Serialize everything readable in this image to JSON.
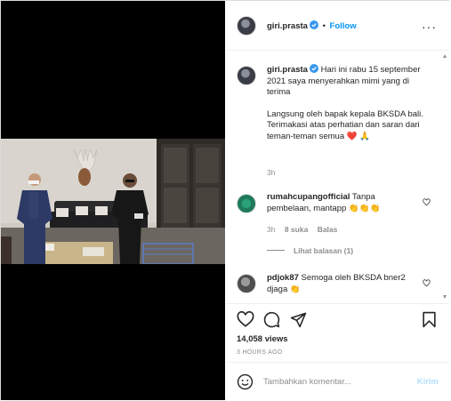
{
  "post": {
    "username": "giri.prasta",
    "separator": "•",
    "follow_label": "Follow",
    "more_label": "···"
  },
  "caption": {
    "username": "giri.prasta",
    "text_1": "Hari ini rabu 15 september 2021 saya menyerahkan mimi yang di terima",
    "text_2": "Langsung oleh bapak kepala BKSDA bali. Terimakasi atas perhatian dan saran dari teman-teman semua",
    "emoji": "❤️ 🙏",
    "time": "3h"
  },
  "comments": [
    {
      "username": "rumahcupangofficial",
      "text": "Tanpa pembelaan, mantapp 👏👏👏",
      "time": "3h",
      "likes": "8 suka",
      "reply_label": "Balas",
      "view_replies": "Lihat balasan (1)"
    },
    {
      "username": "pdjok87",
      "text": "Semoga oleh BKSDA bner2 djaga 👏"
    }
  ],
  "stats": {
    "views": "14,058 views",
    "posted": "3 HOURS AGO"
  },
  "add_comment": {
    "placeholder": "Tambahkan komentar...",
    "submit_label": "Kirim"
  },
  "colors": {
    "accent": "#0095f6",
    "verified": "#3897f0",
    "heart": "#ed4956",
    "muted": "#8e8e8e",
    "submit_disabled": "#b2dffc"
  }
}
